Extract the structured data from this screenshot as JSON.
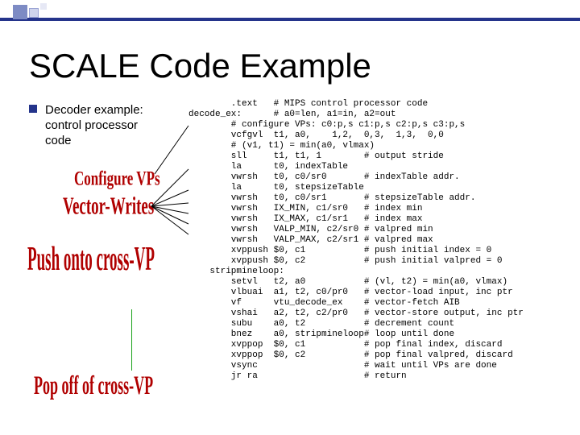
{
  "header": {
    "title": "SCALE Code Example"
  },
  "intro": {
    "line1": "Decoder example:",
    "line2": "control processor",
    "line3": "code"
  },
  "annotations": {
    "configure_vps": "Configure VPs",
    "vector_writes": "Vector-Writes",
    "push_cross_vp": "Push onto cross-VP",
    "stripmine_bar": "|",
    "pop_cross_vp": "Pop off of cross-VP"
  },
  "code_lines": [
    "        .text   # MIPS control processor code",
    "decode_ex:      # a0=len, a1=in, a2=out",
    "        # configure VPs: c0:p,s c1:p,s c2:p,s c3:p,s",
    "        vcfgvl  t1, a0,    1,2,  0,3,  1,3,  0,0",
    "        # (v1, t1) = min(a0, vlmax)",
    "        sll     t1, t1, 1        # output stride",
    "        la      t0, indexTable",
    "        vwrsh   t0, c0/sr0       # indexTable addr.",
    "        la      t0, stepsizeTable",
    "        vwrsh   t0, c0/sr1       # stepsizeTable addr.",
    "        vwrsh   IX_MIN, c1/sr0   # index min",
    "        vwrsh   IX_MAX, c1/sr1   # index max",
    "        vwrsh   VALP_MIN, c2/sr0 # valpred min",
    "        vwrsh   VALP_MAX, c2/sr1 # valpred max",
    "        xvppush $0, c1           # push initial index = 0",
    "        xvppush $0, c2           # push initial valpred = 0",
    "    stripmineloop:",
    "        setvl   t2, a0           # (vl, t2) = min(a0, vlmax)",
    "        vlbuai  a1, t2, c0/pr0   # vector-load input, inc ptr",
    "        vf      vtu_decode_ex    # vector-fetch AIB",
    "        vshai   a2, t2, c2/pr0   # vector-store output, inc ptr",
    "        subu    a0, t2           # decrement count",
    "        bnez    a0, stripmineloop# loop until done",
    "        xvppop  $0, c1           # pop final index, discard",
    "        xvppop  $0, c2           # pop final valpred, discard",
    "        vsync                    # wait until VPs are done",
    "        jr ra                    # return"
  ]
}
